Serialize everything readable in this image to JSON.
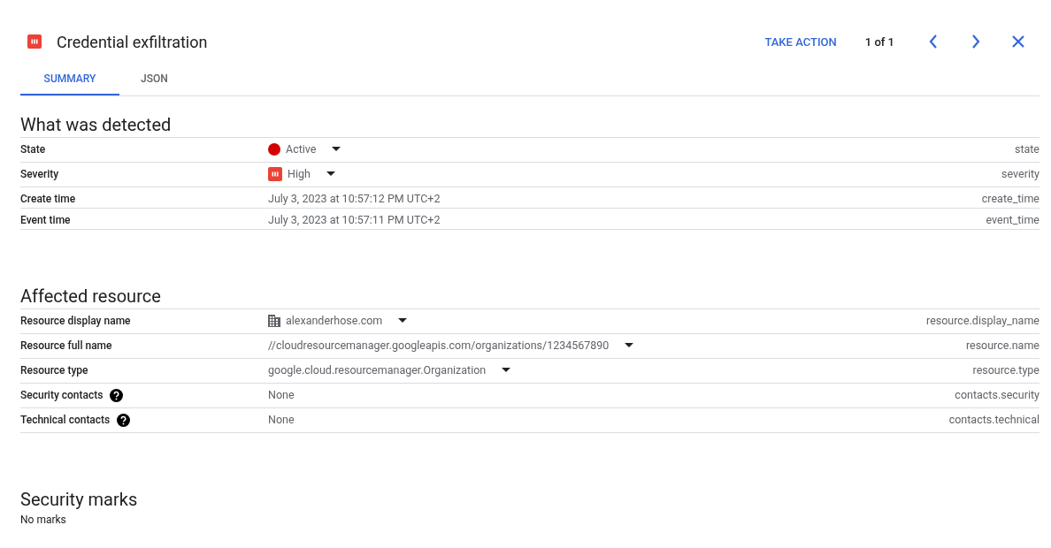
{
  "header": {
    "title": "Credential exfiltration",
    "action": "TAKE ACTION",
    "pager": "1 of 1"
  },
  "tabs": [
    {
      "label": "SUMMARY",
      "selected": true
    },
    {
      "label": "JSON",
      "selected": false
    }
  ],
  "sections": [
    {
      "title": "What was detected",
      "rows": [
        {
          "label": "State",
          "value": "Active",
          "kind": "dot",
          "color": "#d50000",
          "dropdown": true,
          "field": "state"
        },
        {
          "label": "Severity",
          "value": "High",
          "kind": "severity",
          "dropdown": true,
          "field": "severity"
        },
        {
          "label": "Create time",
          "value": "July 3, 2023 at 10:57:12 PM UTC+2",
          "dropdown": false,
          "field": "create_time"
        },
        {
          "label": "Event time",
          "value": "July 3, 2023 at 10:57:11 PM UTC+2",
          "dropdown": false,
          "field": "event_time"
        }
      ]
    },
    {
      "title": "Affected resource",
      "rows": [
        {
          "label": "Resource display name",
          "value": "alexanderhose.com",
          "kind": "building",
          "dropdown": true,
          "field": "resource.display_name"
        },
        {
          "label": "Resource full name",
          "value": "//cloudresourcemanager.googleapis.com/organizations/1234567890",
          "dropdown": true,
          "field": "resource.name"
        },
        {
          "label": "Resource type",
          "value": "google.cloud.resourcemanager.Organization",
          "dropdown": true,
          "field": "resource.type"
        },
        {
          "label": "Security contacts",
          "help": true,
          "value": "None",
          "dropdown": false,
          "field": "contacts.security"
        },
        {
          "label": "Technical contacts",
          "help": true,
          "value": "None",
          "dropdown": false,
          "field": "contacts.technical"
        }
      ]
    },
    {
      "title": "Security marks",
      "note": "No marks"
    }
  ]
}
